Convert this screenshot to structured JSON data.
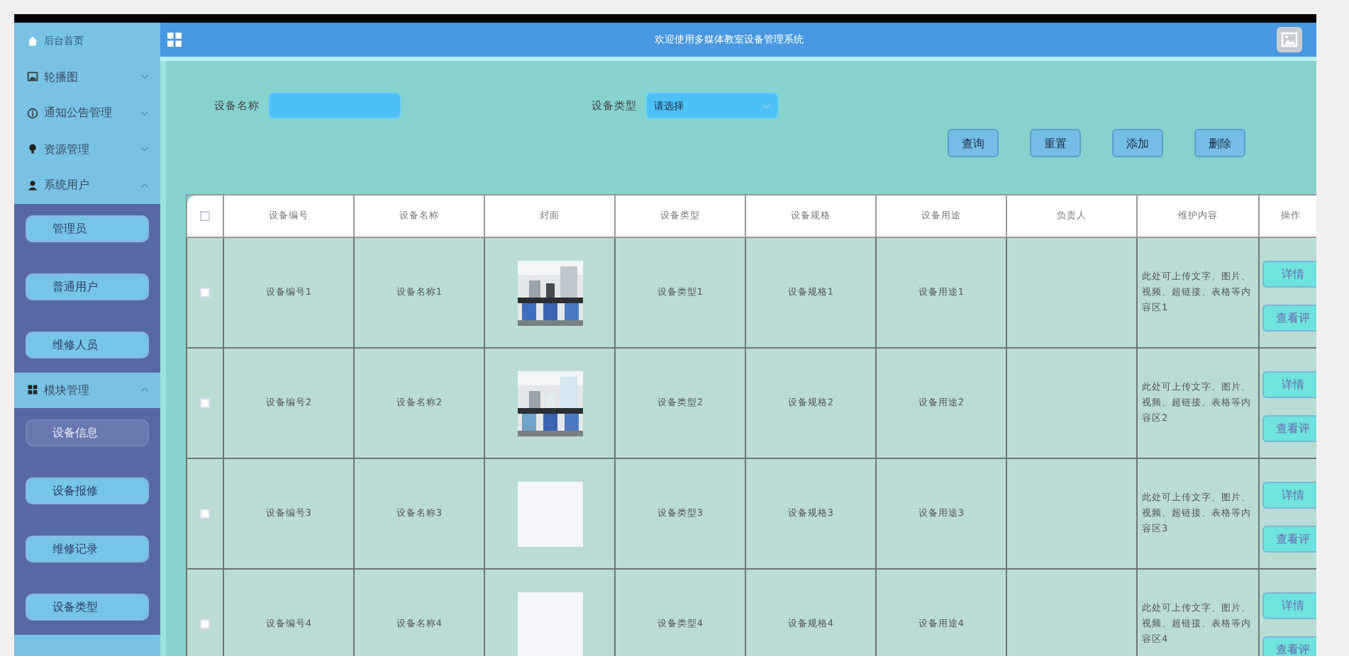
{
  "header": {
    "title": "欢迎使用多媒体教室设备管理系统"
  },
  "sidebar": {
    "items": [
      {
        "label": "后台首页"
      },
      {
        "label": "轮播图",
        "expanded": false
      },
      {
        "label": "通知公告管理",
        "expanded": false
      },
      {
        "label": "资源管理",
        "expanded": false
      },
      {
        "label": "系统用户",
        "expanded": true,
        "children": [
          {
            "label": "管理员",
            "selected": false
          },
          {
            "label": "普通用户",
            "selected": false
          },
          {
            "label": "维修人员",
            "selected": false
          }
        ]
      },
      {
        "label": "模块管理",
        "expanded": true,
        "children": [
          {
            "label": "设备信息",
            "selected": true
          },
          {
            "label": "设备报修",
            "selected": false
          },
          {
            "label": "维修记录",
            "selected": false
          },
          {
            "label": "设备类型",
            "selected": false
          }
        ]
      }
    ]
  },
  "search": {
    "fields": [
      {
        "label": "设备名称",
        "kind": "input"
      },
      {
        "label": "设备类型",
        "kind": "select",
        "value": "请选择"
      }
    ],
    "buttons": [
      "查询",
      "重置",
      "添加",
      "删除"
    ]
  },
  "table": {
    "all_checked": false,
    "columns": [
      "设备编号",
      "设备名称",
      "封面",
      "设备类型",
      "设备规格",
      "设备用途",
      "负责人",
      "维护内容",
      "操作"
    ],
    "rows": [
      {
        "checked": false,
        "code": "设备编号1",
        "name": "设备名称1",
        "cover": {
          "kind": "picture"
        },
        "type": "设备类型1",
        "spec": "设备规格1",
        "usage": "设备用途1",
        "maintenance": "此处可上传文字、图片、视频、超链接、表格等内容区1",
        "actions": [
          "详情",
          "查看评"
        ]
      },
      {
        "checked": false,
        "code": "设备编号2",
        "name": "设备名称2",
        "cover": {
          "kind": "picture"
        },
        "type": "设备类型2",
        "spec": "设备规格2",
        "usage": "设备用途2",
        "maintenance": "此处可上传文字、图片、视频、超链接、表格等内容区2",
        "actions": [
          "详情",
          "查看评"
        ]
      },
      {
        "checked": false,
        "code": "设备编号3",
        "name": "设备名称3",
        "cover": {
          "kind": "blank"
        },
        "type": "设备类型3",
        "spec": "设备规格3",
        "usage": "设备用途3",
        "maintenance": "此处可上传文字、图片、视频、超链接、表格等内容区3",
        "actions": [
          "详情",
          "查看评"
        ]
      },
      {
        "checked": false,
        "code": "设备编号4",
        "name": "设备名称4",
        "cover": {
          "kind": "blank"
        },
        "type": "设备类型4",
        "spec": "设备规格4",
        "usage": "设备用途4",
        "maintenance": "此处可上传文字、图片、视频、超链接、表格等内容区4",
        "actions": [
          "详情",
          "查看评"
        ]
      }
    ]
  }
}
